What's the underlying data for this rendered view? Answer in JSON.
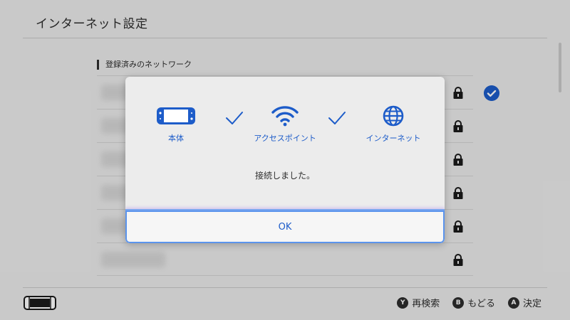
{
  "header": {
    "title": "インターネット設定"
  },
  "networks": {
    "section_label": "登録済みのネットワーク",
    "rows": [
      {
        "name": "■■■■■■■",
        "secured": true,
        "connected": true
      },
      {
        "name": "■■■■■■■",
        "secured": true,
        "connected": false
      },
      {
        "name": "■■■■■■■",
        "secured": true,
        "connected": false
      },
      {
        "name": "■■■■■■■",
        "secured": true,
        "connected": false
      },
      {
        "name": "■■■■■■■",
        "secured": true,
        "connected": false
      },
      {
        "name": "■■■■■■■",
        "secured": true,
        "connected": false
      }
    ]
  },
  "dialog": {
    "steps": [
      {
        "label": "本体",
        "icon": "console-icon"
      },
      {
        "label": "アクセスポイント",
        "icon": "wifi-icon"
      },
      {
        "label": "インターネット",
        "icon": "globe-icon"
      }
    ],
    "message": "接続しました。",
    "ok_label": "OK"
  },
  "footer": {
    "actions": [
      {
        "button": "Y",
        "label": "再検索"
      },
      {
        "button": "B",
        "label": "もどる"
      },
      {
        "button": "A",
        "label": "決定"
      }
    ]
  },
  "colors": {
    "accent": "#1d5cc9",
    "background": "#ebebeb",
    "dialog": "#ececec"
  }
}
